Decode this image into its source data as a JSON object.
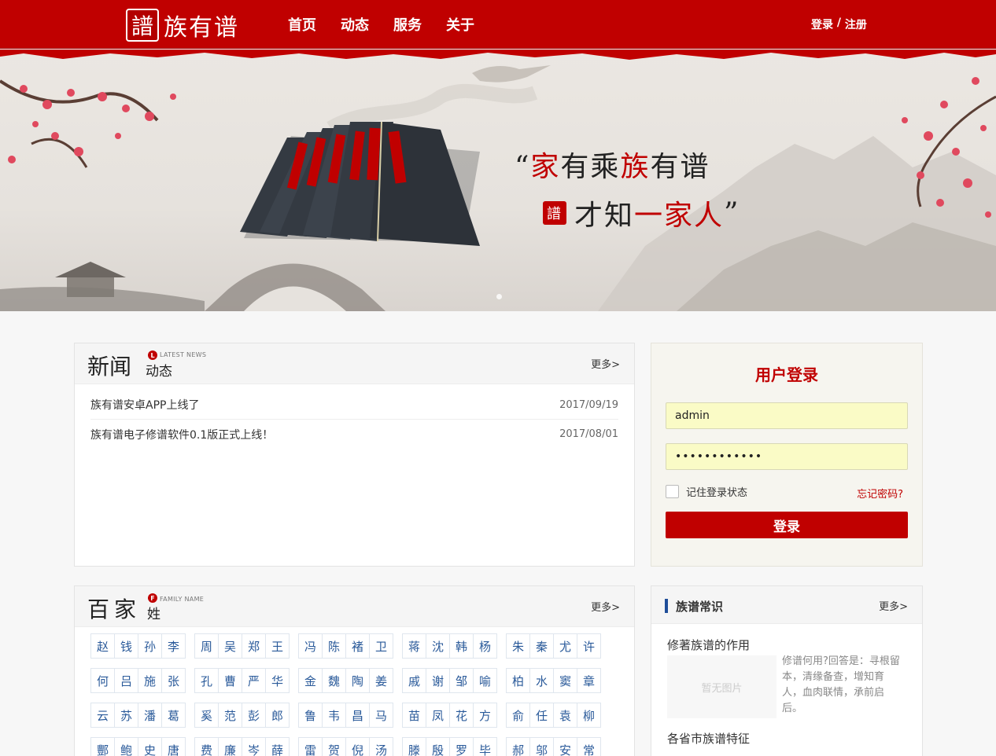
{
  "header": {
    "logo_seal": "譜",
    "logo_text": "族有谱",
    "nav": [
      "首页",
      "动态",
      "服务",
      "关于"
    ],
    "login": "登录",
    "sep": " / ",
    "register": "注册"
  },
  "banner": {
    "quote_open": "“",
    "line1_a": "家",
    "line1_b": "有乘",
    "line1_c": "族",
    "line1_d": "有谱",
    "seal": "譜",
    "line2_a": "才知",
    "line2_b": "一家人",
    "quote_close": "”"
  },
  "news": {
    "title": "新闻",
    "sub": "动态",
    "badge": "L",
    "eng": "LATEST NEWS",
    "more": "更多>",
    "items": [
      {
        "title": "族有谱安卓APP上线了",
        "date": "2017/09/19"
      },
      {
        "title": "族有谱电子修谱软件0.1版正式上线！",
        "date": "2017/08/01"
      }
    ]
  },
  "login": {
    "title": "用户登录",
    "username": "admin",
    "password": "••••••••••••",
    "remember": "记住登录状态",
    "forgot": "忘记密码?",
    "submit": "登录"
  },
  "surnames": {
    "title": "百家",
    "sub": "姓",
    "badge": "F",
    "eng": "FAMILY NAME",
    "more": "更多>",
    "rows": [
      [
        [
          "赵",
          "钱",
          "孙",
          "李"
        ],
        [
          "周",
          "吴",
          "郑",
          "王"
        ],
        [
          "冯",
          "陈",
          "褚",
          "卫"
        ],
        [
          "蒋",
          "沈",
          "韩",
          "杨"
        ],
        [
          "朱",
          "秦",
          "尤",
          "许"
        ]
      ],
      [
        [
          "何",
          "吕",
          "施",
          "张"
        ],
        [
          "孔",
          "曹",
          "严",
          "华"
        ],
        [
          "金",
          "魏",
          "陶",
          "姜"
        ],
        [
          "戚",
          "谢",
          "邹",
          "喻"
        ],
        [
          "柏",
          "水",
          "窦",
          "章"
        ]
      ],
      [
        [
          "云",
          "苏",
          "潘",
          "葛"
        ],
        [
          "奚",
          "范",
          "彭",
          "郎"
        ],
        [
          "鲁",
          "韦",
          "昌",
          "马"
        ],
        [
          "苗",
          "凤",
          "花",
          "方"
        ],
        [
          "俞",
          "任",
          "袁",
          "柳"
        ]
      ],
      [
        [
          "酆",
          "鲍",
          "史",
          "唐"
        ],
        [
          "费",
          "廉",
          "岑",
          "薛"
        ],
        [
          "雷",
          "贺",
          "倪",
          "汤"
        ],
        [
          "滕",
          "殷",
          "罗",
          "毕"
        ],
        [
          "郝",
          "邬",
          "安",
          "常"
        ]
      ]
    ]
  },
  "knowledge": {
    "title": "族谱常识",
    "more": "更多>",
    "item1_title": "修著族谱的作用",
    "noimg": "暂无图片",
    "item1_desc": "修谱何用?回答是：寻根留本，清缘备查，增知育人，血肉联情，承前启后。",
    "item2_title": "各省市族谱特征"
  }
}
